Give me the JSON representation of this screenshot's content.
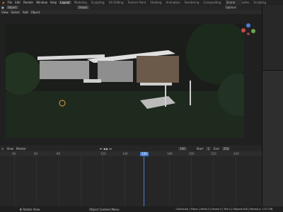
{
  "menu": [
    "Blender",
    "File",
    "Edit",
    "Render",
    "Window",
    "Help"
  ],
  "workspaces": [
    "Layout",
    "Modeling",
    "Sculpting",
    "UV Editing",
    "Texture Paint",
    "Shading",
    "Animation",
    "Rendering",
    "Compositing",
    "Geometry Nodes",
    "Scripting"
  ],
  "active_workspace": "Layout",
  "scene_name": "Scene",
  "viewport": {
    "mode": "Object",
    "view_menu": [
      "View",
      "Select",
      "Add",
      "Object"
    ],
    "shading_label": "Options",
    "transform": "Global"
  },
  "timeline": {
    "menus": [
      "Playback",
      "Keying",
      "View",
      "Marker"
    ],
    "current_frame": "100",
    "start_label": "Start",
    "start": "1",
    "end_label": "End",
    "end": "250",
    "ticks": [
      "40",
      "60",
      "80",
      "100",
      "120",
      "140",
      "160",
      "180",
      "200",
      "220",
      "240"
    ]
  },
  "status": {
    "left": "Rotate View",
    "mid": "Object Context Menu",
    "right": "Collection | Plane | Verts:0 | Faces:0 | Tris:0 | Objects:0/8 | Memory: 1.07 GiB"
  },
  "colors": {
    "accent": "#4a7fd3",
    "bg": "#1d1d1d"
  }
}
